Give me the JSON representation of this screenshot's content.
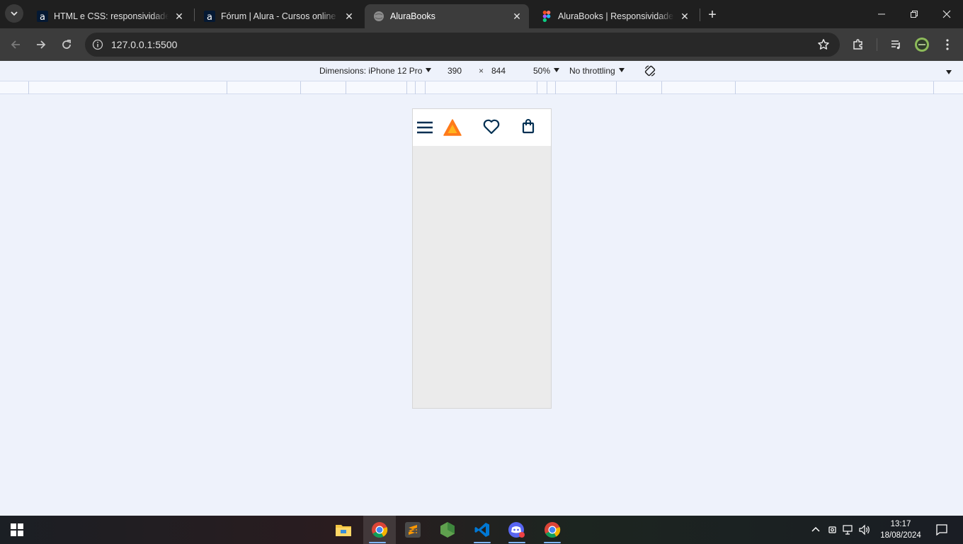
{
  "browser": {
    "tabs": [
      {
        "title": "HTML e CSS: responsividade com",
        "favicon": "alura-icon",
        "active": false
      },
      {
        "title": "Fórum | Alura - Cursos online de",
        "favicon": "alura-icon",
        "active": false
      },
      {
        "title": "AluraBooks",
        "favicon": "globe-icon",
        "active": true
      },
      {
        "title": "AluraBooks | Responsividade com",
        "favicon": "figma-icon",
        "active": false
      }
    ],
    "new_tab": "+",
    "url": "127.0.0.1:5500"
  },
  "devtools": {
    "dimensions_label": "Dimensions: iPhone 12 Pro",
    "width": "390",
    "times": "×",
    "height": "844",
    "zoom": "50%",
    "throttling": "No throttling"
  },
  "taskbar": {
    "apps": [
      "file-explorer-icon",
      "chrome-icon",
      "sublime-text-icon",
      "nodejs-icon",
      "vscode-icon",
      "discord-icon",
      "chrome-icon"
    ],
    "time": "13:17",
    "date": "18/08/2024"
  },
  "colors": {
    "tabstrip": "#1f1f1f",
    "toolbar": "#3c3c3c",
    "page_bg": "#eef2fb",
    "logo_orange": "#ff7a1a",
    "logo_yellow": "#ffb51f",
    "icon_navy": "#002f52"
  }
}
